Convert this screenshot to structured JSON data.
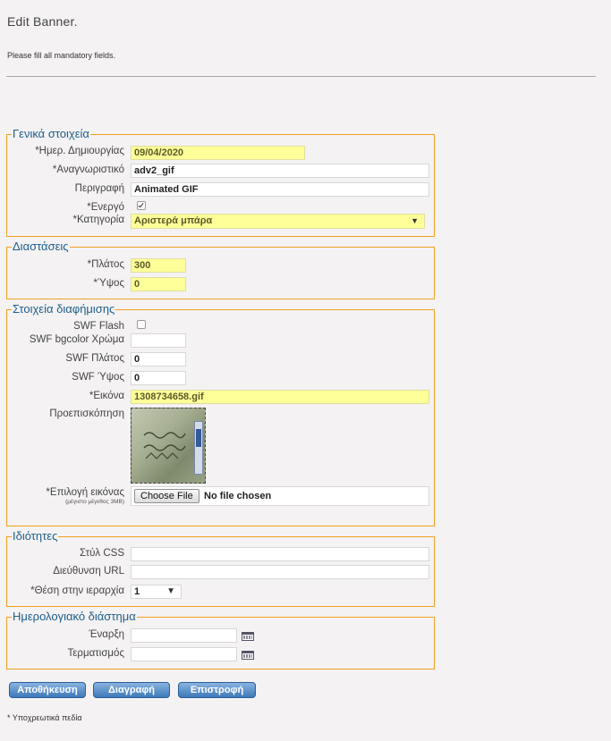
{
  "page": {
    "title": "Edit Banner.",
    "notice": "Please fill all mandatory fields.",
    "footnote": "* Υποχρεωτικά πεδία"
  },
  "general": {
    "legend": "Γενικά στοιχεία",
    "created_label": "*Ημερ. Δημιουργίας",
    "created_value": "09/04/2020",
    "identifier_label": "*Αναγνωριστικό",
    "identifier_value": "adv2_gif",
    "description_label": "Περιγραφή",
    "description_value": "Animated GIF",
    "active_label": "*Ενεργό",
    "active_checked": true,
    "category_label": "*Κατηγορία",
    "category_value": "Αριστερά μπάρα"
  },
  "dimensions": {
    "legend": "Διαστάσεις",
    "width_label": "*Πλάτος",
    "width_value": "300",
    "height_label": "*Ύψος",
    "height_value": "0"
  },
  "ad": {
    "legend": "Στοιχεία διαφήμισης",
    "swf_flash_label": "SWF Flash",
    "swf_flash_checked": false,
    "swf_bgcolor_label": "SWF bgcolor Χρώμα",
    "swf_bgcolor_value": "",
    "swf_width_label": "SWF Πλάτος",
    "swf_width_value": "0",
    "swf_height_label": "SWF Ύψος",
    "swf_height_value": "0",
    "image_label": "*Εικόνα",
    "image_value": "1308734658.gif",
    "preview_label": "Προεπισκόπηση",
    "select_image_label": "*Επιλογή εικόνας",
    "select_image_hint": "(μέγιστο μέγεθος 3MB)",
    "choose_file_label": "Choose File",
    "no_file_text": "No file chosen"
  },
  "properties": {
    "legend": "Ιδιότητες",
    "css_label": "Στύλ CSS",
    "css_value": "",
    "url_label": "Διεύθυνση URL",
    "url_value": "",
    "position_label": "*Θέση στην ιεραρχία",
    "position_value": "1"
  },
  "schedule": {
    "legend": "Ημερολογιακό διάστημα",
    "start_label": "Έναρξη",
    "start_value": "",
    "end_label": "Τερματισμός",
    "end_value": ""
  },
  "actions": {
    "save_label": "Αποθήκευση",
    "delete_label": "Διαγραφή",
    "back_label": "Επιστροφή"
  },
  "icons": {
    "dropdown": "chevron-down-icon",
    "calendar": "calendar-icon",
    "checkmark": "checkmark-icon"
  },
  "colors": {
    "legend_text": "#1e5e8c",
    "fieldset_border": "#f0a020",
    "required_field": "#ffff99",
    "button_top": "#8ab4e0",
    "button_bottom": "#3d78b8"
  }
}
